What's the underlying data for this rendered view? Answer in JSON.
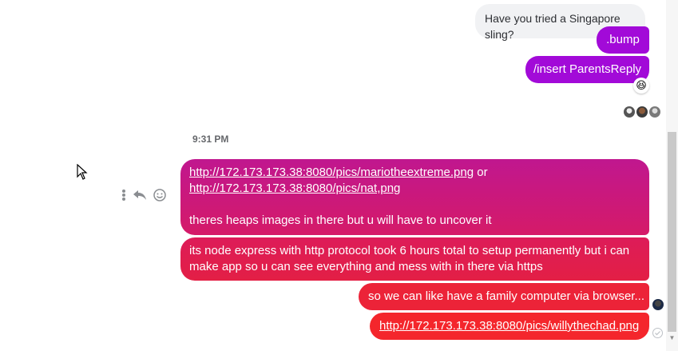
{
  "messages": {
    "incoming_gray": "Have you tried a Singapore sling?",
    "bump": ".bump",
    "insert": "/insert ParentsReply",
    "reaction_emoji": "😆",
    "timestamp": "9:31 PM",
    "m1_link1": "http://172.173.173.38:8080/pics/mariotheextreme.png",
    "m1_or": " or",
    "m1_link2": "http://172.173.173.38:8080/pics/nat,png",
    "m1_text": "theres heaps images in there but u will have to uncover it",
    "m2_text": "its node express with http protocol took 6 hours total to setup permanently but i can make app so u can see everything and mess with in there via https",
    "m3_text": "so we can like have a family computer via browser...",
    "m4_link": "http://172.173.173.38:8080/pics/willythechad.png"
  },
  "colors": {
    "purple": "#a20ad8",
    "magenta": "#c0178f",
    "red": "#f4262c"
  },
  "icons": [
    "more-options-icon",
    "reply-icon",
    "emoji-reaction-icon",
    "seen-avatar",
    "sent-check-icon"
  ]
}
